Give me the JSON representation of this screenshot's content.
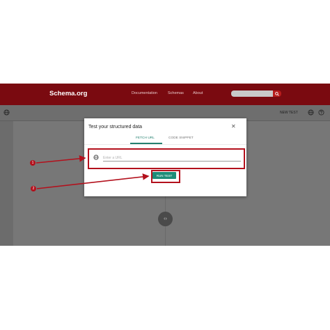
{
  "header": {
    "brand": "Schema.org",
    "nav": [
      "Documentation",
      "Schemas",
      "About"
    ]
  },
  "toolbar": {
    "new_test_label": "NEW TEST"
  },
  "dialog": {
    "title": "Test your structured data",
    "tabs": [
      {
        "label": "FETCH URL",
        "active": true
      },
      {
        "label": "CODE SNIPPET",
        "active": false
      }
    ],
    "url_placeholder": "Enter a URL",
    "run_label": "RUN TEST"
  },
  "callouts": [
    "1",
    "2"
  ],
  "colors": {
    "header_bg": "#7a0a10",
    "accent": "#1d8c78",
    "annotation": "#b3101c"
  },
  "icons": [
    "search-icon",
    "globe-icon",
    "help-icon",
    "close-icon",
    "code-icon"
  ]
}
